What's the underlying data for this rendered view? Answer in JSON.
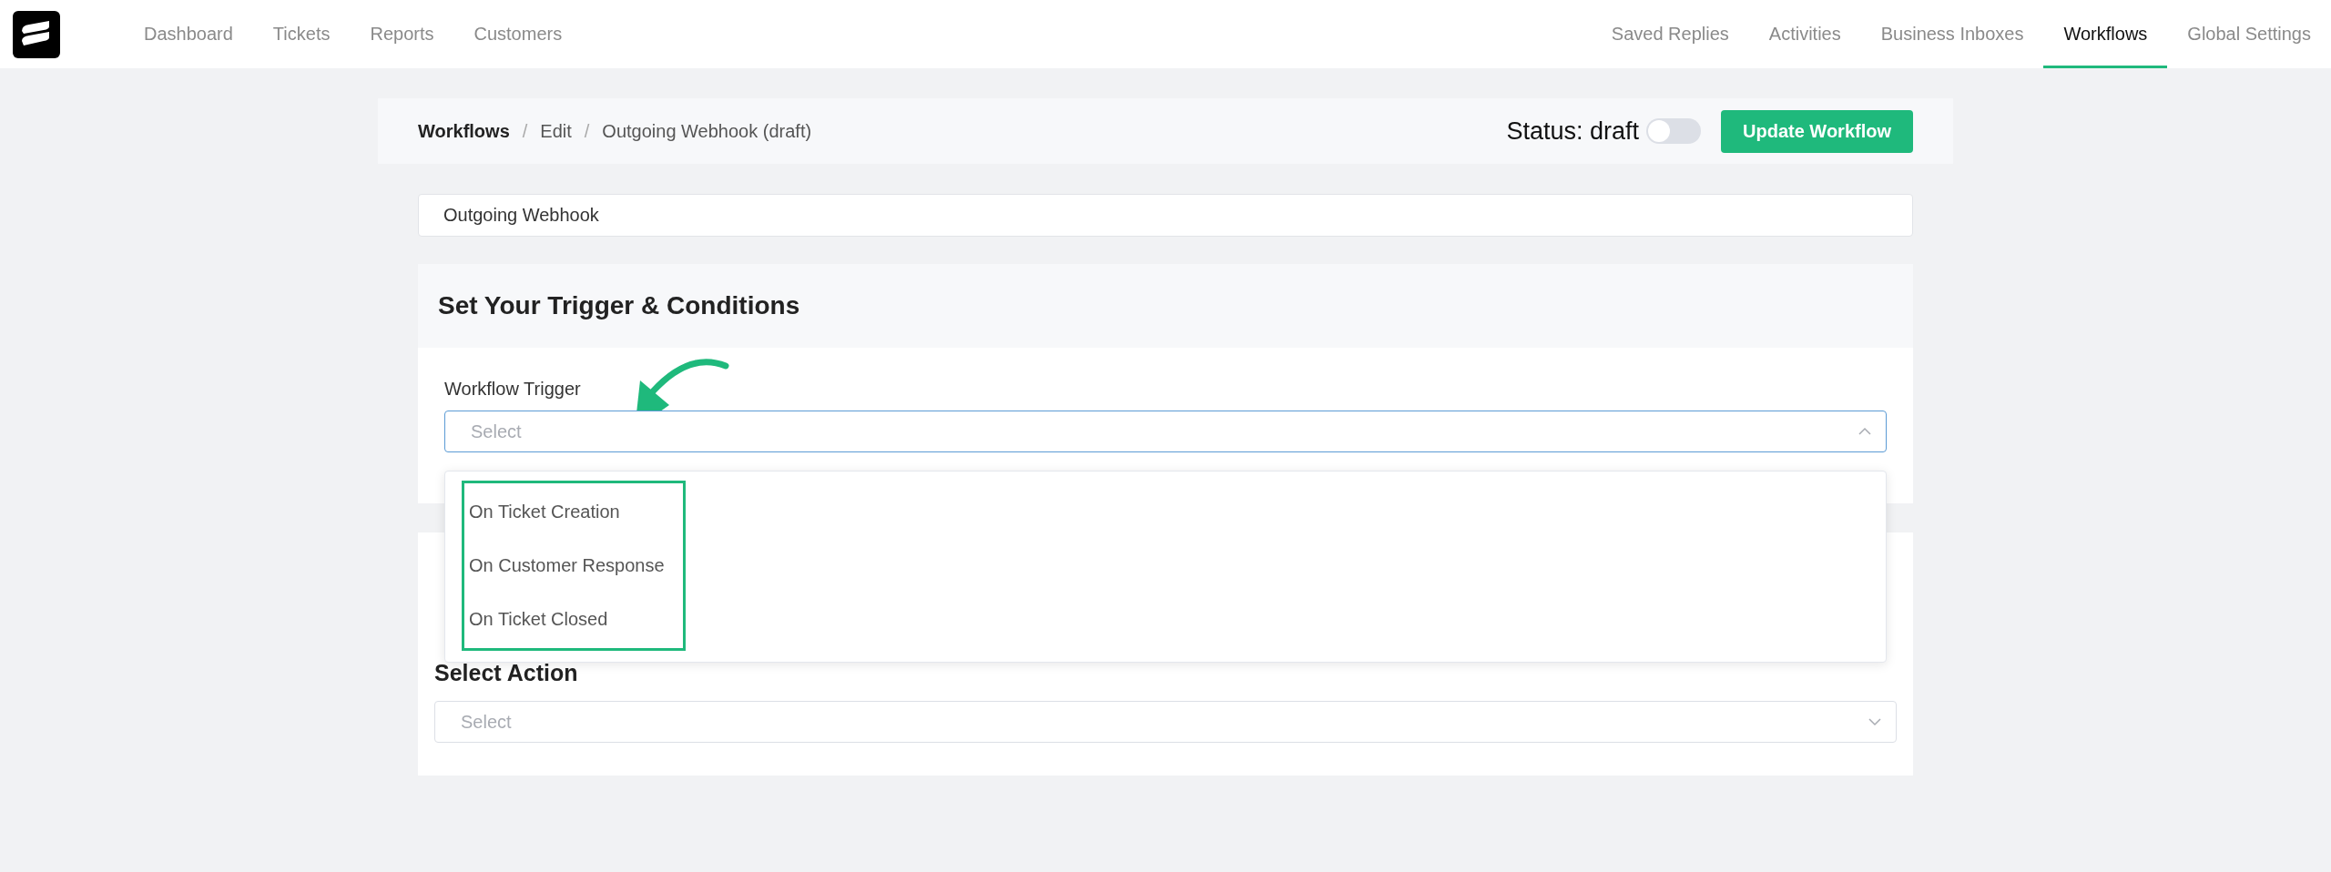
{
  "nav": {
    "left_items": [
      {
        "label": "Dashboard",
        "selected": false
      },
      {
        "label": "Tickets",
        "selected": false
      },
      {
        "label": "Reports",
        "selected": false
      },
      {
        "label": "Customers",
        "selected": false
      }
    ],
    "right_items": [
      {
        "label": "Saved Replies",
        "selected": false
      },
      {
        "label": "Activities",
        "selected": false
      },
      {
        "label": "Business Inboxes",
        "selected": false
      },
      {
        "label": "Workflows",
        "selected": true
      },
      {
        "label": "Global Settings",
        "selected": false
      }
    ]
  },
  "breadcrumb": [
    {
      "label": "Workflows",
      "kind": "link"
    },
    {
      "label": "/",
      "kind": "separator"
    },
    {
      "label": "Edit",
      "kind": "link"
    },
    {
      "label": "/",
      "kind": "separator"
    },
    {
      "label": "Outgoing Webhook (draft)",
      "kind": "current"
    }
  ],
  "status": {
    "label": "Status: draft",
    "on": false
  },
  "update_button": "Update Workflow",
  "name_field": {
    "value": "Outgoing Webhook"
  },
  "trigger_section": {
    "title": "Set Your Trigger & Conditions",
    "field_label": "Workflow Trigger",
    "select": {
      "placeholder": "Select",
      "expanded": true
    },
    "options": [
      "On Ticket Creation",
      "On Customer Response",
      "On Ticket Closed"
    ]
  },
  "action_section": {
    "title": "Select Action",
    "select": {
      "placeholder": "Select",
      "expanded": false
    }
  }
}
